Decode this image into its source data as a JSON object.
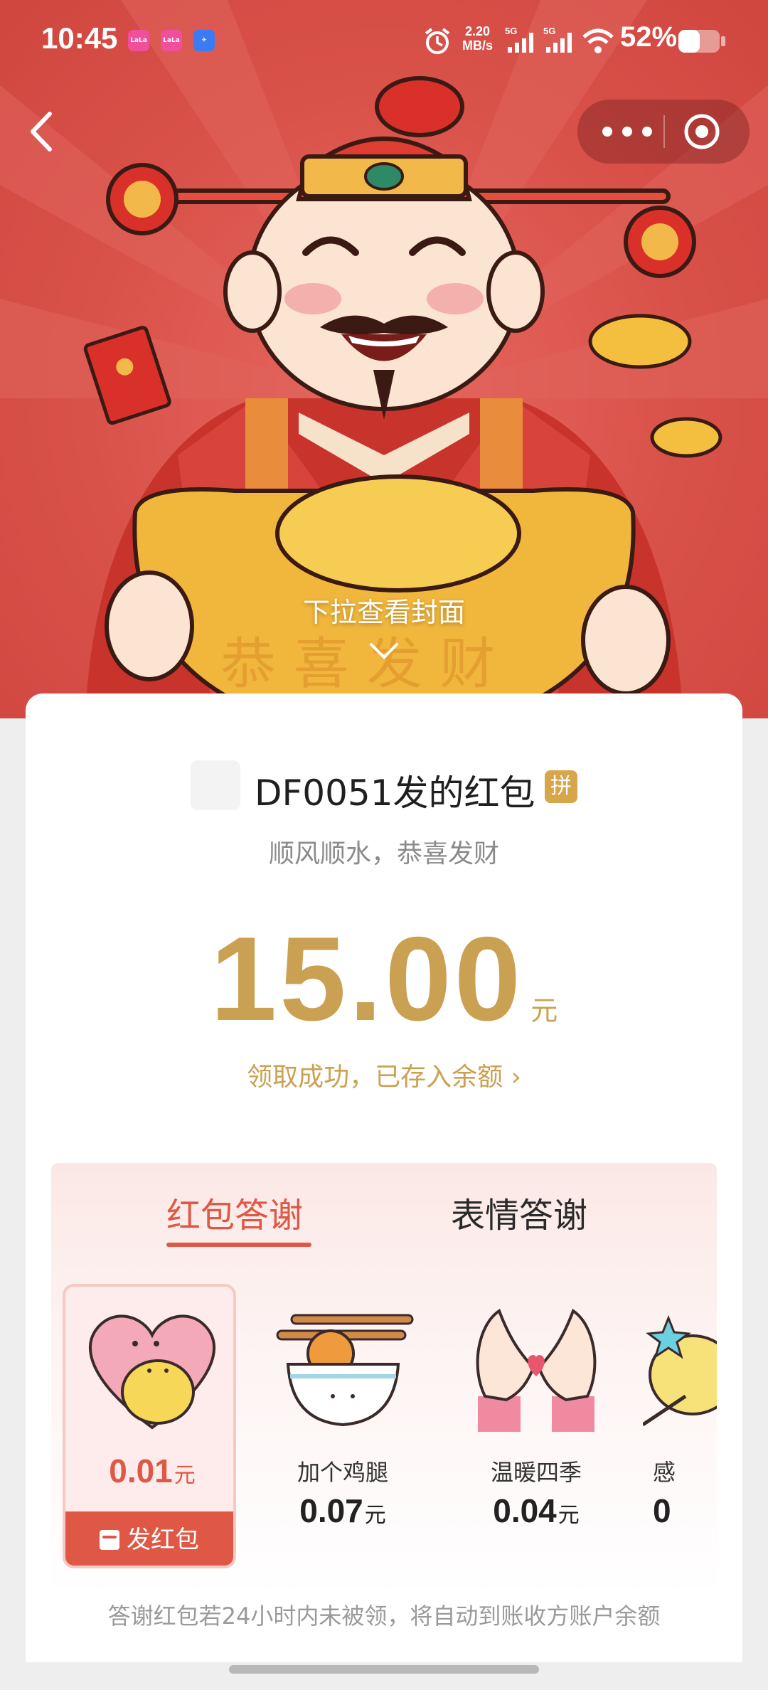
{
  "status_bar": {
    "time": "10:45",
    "app_badges": [
      "LaLa",
      "LaLa",
      "Feishu"
    ],
    "net_speed_value": "2.20",
    "net_speed_unit": "MB/s",
    "signal_1": "5G",
    "signal_2": "5G",
    "battery_percent": "52%",
    "icons": [
      "alarm-icon",
      "wifi-icon",
      "battery-icon"
    ]
  },
  "nav": {
    "back_icon": "chevron-left-icon",
    "more_icon": "more-dots-icon",
    "close_icon": "target-circle-icon"
  },
  "cover": {
    "pull_hint": "下拉查看封面",
    "arrow_icon": "chevron-down-icon"
  },
  "packet": {
    "sender": "DF0051发的红包",
    "badge": "拼",
    "greeting": "顺风顺水，恭喜发财",
    "amount": "15.00",
    "unit": "元",
    "status": "领取成功，已存入余额 ›"
  },
  "thanks": {
    "tabs": [
      "红包答谢",
      "表情答谢"
    ],
    "active_tab": 0,
    "items": [
      {
        "name": "",
        "price": "0.01",
        "unit": "元",
        "icon": "heart-hug-icon",
        "selected": true
      },
      {
        "name": "加个鸡腿",
        "price": "0.07",
        "unit": "元",
        "icon": "drumstick-bowl-icon"
      },
      {
        "name": "温暖四季",
        "price": "0.04",
        "unit": "元",
        "icon": "heart-hands-icon"
      },
      {
        "name": "感",
        "price": "0",
        "unit": "",
        "icon": "star-character-icon"
      }
    ],
    "send_button": "发红包"
  },
  "footer": {
    "note": "答谢红包若24小时内未被领，将自动到账收方账户余额"
  },
  "colors": {
    "cover_red": "#d9524a",
    "accent_red": "#de5845",
    "gold": "#caa152"
  }
}
